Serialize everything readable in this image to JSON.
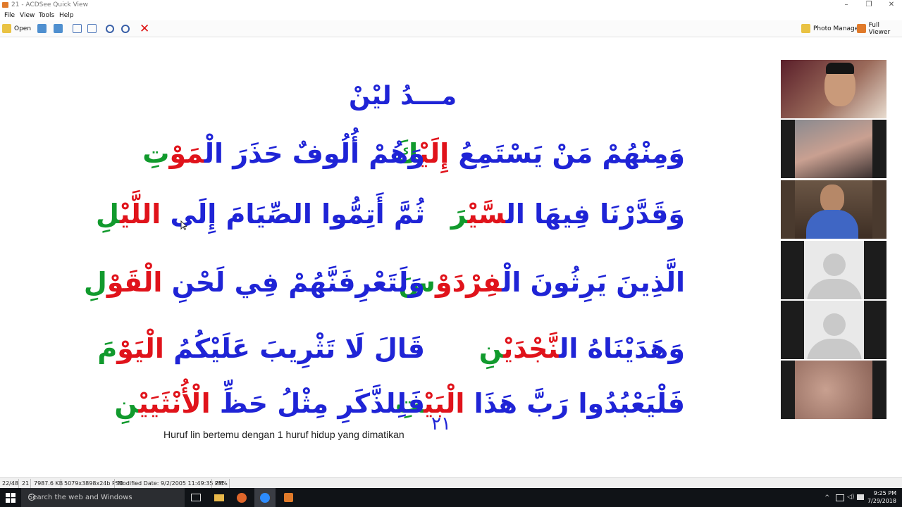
{
  "window": {
    "title": "21 - ACDSee Quick View",
    "controls": [
      "–",
      "❐",
      "✕"
    ]
  },
  "menu": [
    "File",
    "View",
    "Tools",
    "Help"
  ],
  "toolbar": {
    "open_label": "Open",
    "photo_manager_label": "Photo Manager",
    "full_viewer_label": "Full Viewer"
  },
  "page": {
    "title": "مـــدُ ليْنْ",
    "rows": [
      {
        "right": [
          "وَمِنْهُمْ مَنْ يَسْتَمِعُ ",
          "إِلَيْ",
          "كَ"
        ],
        "left": [
          "وَهُمْ أُلُوفٌ حَذَرَ الْ",
          "مَوْ",
          "تِ"
        ]
      },
      {
        "right": [
          "وَقَدَّرْنَا فِيهَا ال",
          "سَّيْ",
          "رَ"
        ],
        "left": [
          "ثُمَّ أَتِمُّوا الصِّيَامَ إِلَى ",
          "اللَّيْ",
          "لِ"
        ]
      },
      {
        "right": [
          "الَّذِينَ يَرِثُونَ الْ",
          "فِرْدَوْ",
          "سَ"
        ],
        "left": [
          "وَلَتَعْرِفَنَّهُمْ فِي لَحْنِ ",
          "الْقَوْ",
          "لِ"
        ]
      },
      {
        "right": [
          "وَهَدَيْنَاهُ ال",
          "نَّجْدَيْ",
          "نِ"
        ],
        "left": [
          "قَالَ لَا تَثْرِيبَ عَلَيْكُمُ ",
          "الْيَوْ",
          "مَ"
        ]
      },
      {
        "right": [
          "فَلْيَعْبُدُوا رَبَّ هَذَا ",
          "الْبَيْ",
          "تِ"
        ],
        "left": [
          "فَلِلذَّكَرِ مِثْلُ حَظِّ ",
          "الْأُنْثَيَيْ",
          "نِ"
        ]
      }
    ],
    "caption": "Huruf lin bertemu dengan 1 huruf hidup yang dimatikan",
    "page_number": "٢١"
  },
  "participants": [
    "participant-1",
    "participant-2",
    "participant-3",
    "participant-4",
    "participant-5",
    "participant-6"
  ],
  "status": {
    "index": "22/48",
    "name": "21",
    "size": "7987.6 KB",
    "dimensions": "5079x3898x24b PSD",
    "modified": "Modified Date: 9/2/2005 11:49:35 PM",
    "zoom": "24%"
  },
  "taskbar": {
    "search_placeholder": "Search the web and Windows",
    "time": "9:25 PM",
    "date": "7/29/2018"
  },
  "colors": {
    "blue": "#1f24d6",
    "red": "#e0131b",
    "green": "#119a2d"
  }
}
